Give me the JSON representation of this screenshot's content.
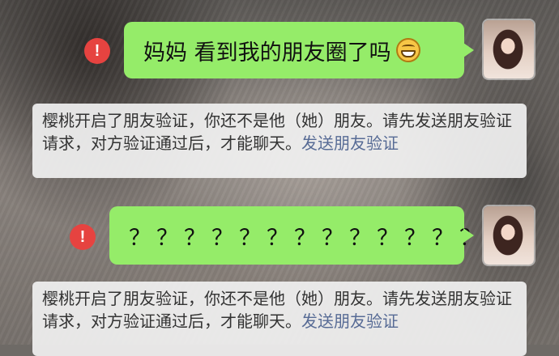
{
  "messages": [
    {
      "text": "妈妈 看到我的朋友圈了吗",
      "emoji": "grinning-face-emoji",
      "status": "send-failed"
    },
    {
      "text": "？？？？？？？？？？？？？",
      "status": "send-failed"
    }
  ],
  "system_notices": [
    {
      "text": "樱桃开启了朋友验证，你还不是他（她）朋友。请先发送朋友验证请求，对方验证通过后，才能聊天。",
      "link": "发送朋友验证"
    },
    {
      "text": "樱桃开启了朋友验证，你还不是他（她）朋友。请先发送朋友验证请求，对方验证通过后，才能聊天。",
      "link": "发送朋友验证"
    }
  ],
  "error_icon_glyph": "!",
  "colors": {
    "bubble": "#95ec69",
    "error": "#e64340",
    "link": "#576b95",
    "notice_bg": "#f0f0f0"
  }
}
